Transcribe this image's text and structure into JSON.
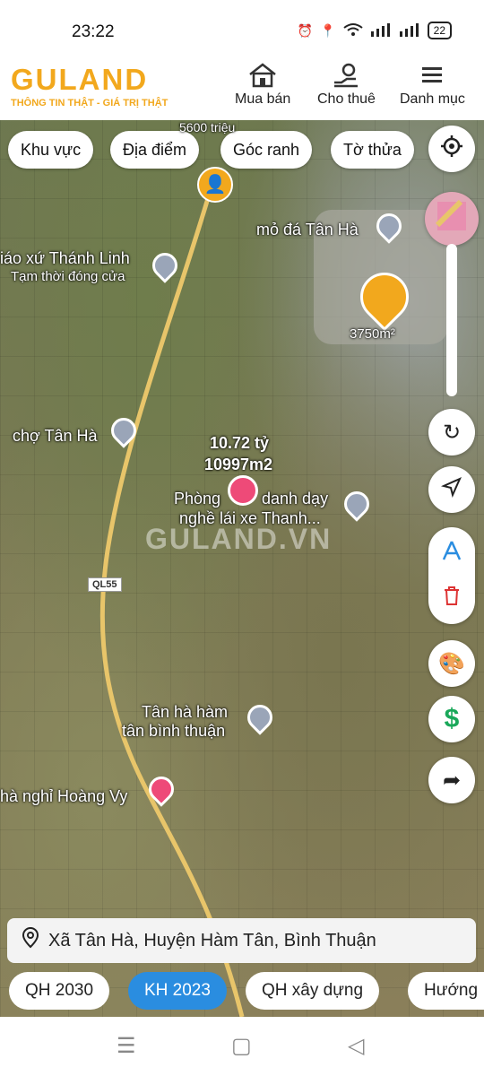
{
  "status": {
    "time": "23:22",
    "battery": "22"
  },
  "header": {
    "logo": "GULAND",
    "tagline": "THÔNG TIN THẬT - GIÁ TRỊ THẬT",
    "nav": [
      {
        "label": "Mua bán",
        "icon": "house-icon"
      },
      {
        "label": "Cho thuê",
        "icon": "hand-key-icon"
      },
      {
        "label": "Danh mục",
        "icon": "menu-icon"
      }
    ]
  },
  "filters": [
    "Khu vực",
    "Địa điểm",
    "Góc ranh",
    "Tờ thửa"
  ],
  "map": {
    "labels": {
      "quarry": "mỏ đá Tân Hà",
      "church": "iáo xứ Thánh Linh",
      "church_sub": "Tạm thời đóng cửa",
      "market": "chợ Tân Hà",
      "listing_price": "10.72 tỷ",
      "listing_area": "10997m2",
      "school": "Phòng",
      "school_rest": "danh dạy",
      "school_line2": "nghề lái xe Thanh...",
      "tanha": "Tân hà hàm",
      "tanha2": "tân bình thuận",
      "motel": "hà nghỉ Hoàng Vy",
      "area_marker": "3750m²",
      "top_marker": "5600 triệu",
      "road": "QL55",
      "watermark": "GULAND.VN"
    }
  },
  "address": "Xã Tân Hà, Huyện Hàm Tân, Bình Thuận",
  "tabs": [
    {
      "label": "QH 2030",
      "active": false
    },
    {
      "label": "KH 2023",
      "active": true
    },
    {
      "label": "QH xây dựng",
      "active": false
    },
    {
      "label": "Hướng",
      "active": false
    }
  ]
}
